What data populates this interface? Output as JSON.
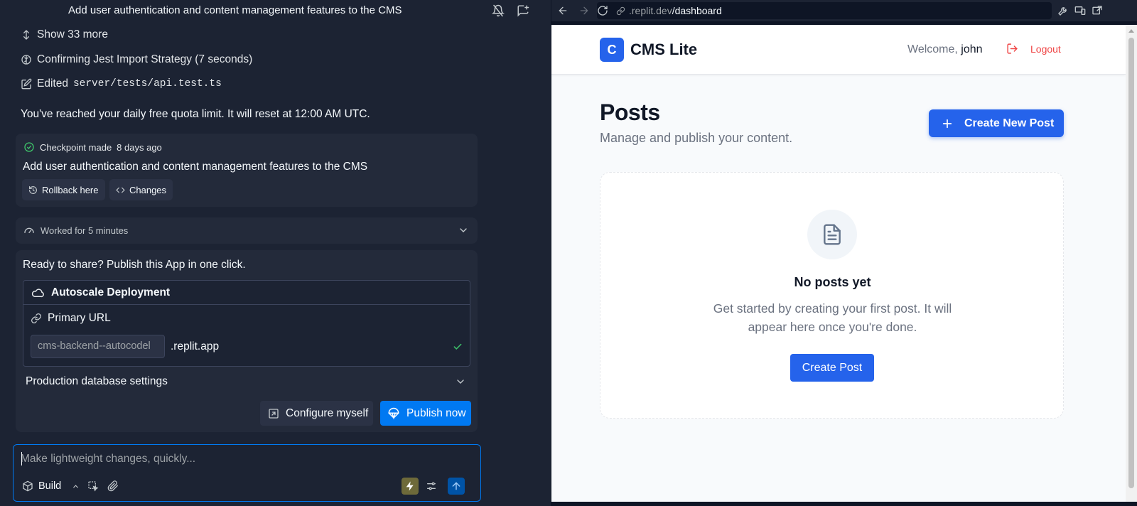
{
  "agent": {
    "task_title": "Add user authentication and content management features to the CMS",
    "show_more": "Show 33 more",
    "thinking": "Confirming Jest Import Strategy (7 seconds)",
    "edited_label": "Edited",
    "edited_file": "server/tests/api.test.ts",
    "quota_notice": "You've reached your daily free quota limit. It will reset at 12:00 AM UTC.",
    "checkpoint": {
      "label": "Checkpoint made",
      "time": "8 days ago",
      "message": "Add user authentication and content management features to the CMS",
      "rollback": "Rollback here",
      "changes": "Changes"
    },
    "worked": "Worked for 5 minutes",
    "publish": {
      "ready": "Ready to share? Publish this App in one click.",
      "deployment_type": "Autoscale Deployment",
      "primary_url_label": "Primary URL",
      "subdomain": "cms-backend--autocodel",
      "domain_suffix": ".replit.app",
      "db_settings": "Production database settings",
      "configure": "Configure myself",
      "publish_now": "Publish now"
    },
    "composer": {
      "placeholder": "Make lightweight changes, quickly...",
      "mode": "Build"
    }
  },
  "browser": {
    "url_host": ".replit.dev",
    "url_path": "/dashboard"
  },
  "app": {
    "logo_letter": "C",
    "name": "CMS Lite",
    "welcome_prefix": "Welcome,",
    "username": "john",
    "logout": "Logout",
    "page_title": "Posts",
    "page_subtitle": "Manage and publish your content.",
    "create_new_post": "Create New Post",
    "empty_title": "No posts yet",
    "empty_text": "Get started by creating your first post. It will appear here once you're done.",
    "create_post": "Create Post"
  },
  "colors": {
    "accent_blue": "#0079f2",
    "app_primary": "#2563eb",
    "success_green": "#3ec66b",
    "logout_red": "#ef4444"
  },
  "icons": {
    "chevron_expand": "chevron-up-down-icon",
    "brain": "brain-icon",
    "edit": "edit-file-icon",
    "check": "check-circle-icon",
    "rollback": "history-icon",
    "code": "code-icon",
    "speed": "gauge-icon",
    "cloud": "cloud-icon",
    "link": "link-icon",
    "document": "document-icon",
    "logout": "logout-icon"
  }
}
